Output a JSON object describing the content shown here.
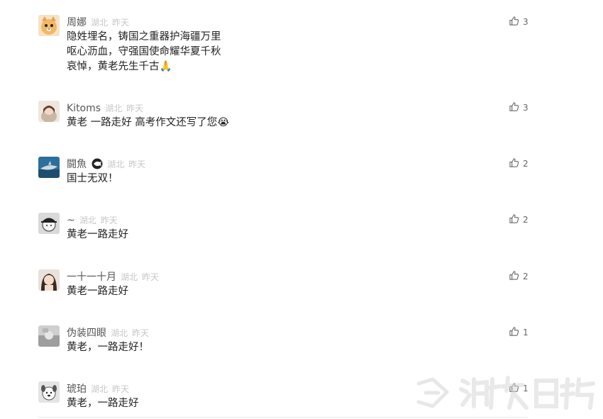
{
  "comments": [
    {
      "username": "周娜",
      "location": "湖北",
      "time": "昨天",
      "lines": [
        "隐姓埋名，铸国之重器护海疆万里",
        "呕心沥血，守强国使命耀华夏千秋",
        "哀悼，黄老先生千古🙏"
      ],
      "likes": "3",
      "avatar_icon": "cartoon-cat-avatar-icon"
    },
    {
      "username": "Kitoms",
      "location": "湖北",
      "time": "昨天",
      "lines": [
        "黄老 一路走好 高考作文还写了您😭"
      ],
      "likes": "3",
      "avatar_icon": "girl-photo-avatar-icon"
    },
    {
      "username": "闘魚",
      "location": "湖北",
      "time": "昨天",
      "lines": [
        "国士无双！"
      ],
      "likes": "2",
      "avatar_icon": "shark-photo-avatar-icon",
      "badge_icon": "fish-badge-icon"
    },
    {
      "username": "~",
      "location": "湖北",
      "time": "昨天",
      "lines": [
        "黄老一路走好"
      ],
      "likes": "2",
      "avatar_icon": "cartoon-cap-avatar-icon"
    },
    {
      "username": "一十一十月",
      "location": "湖北",
      "time": "昨天",
      "lines": [
        "黄老一路走好"
      ],
      "likes": "2",
      "avatar_icon": "woman-photo-avatar-icon"
    },
    {
      "username": "伪装四眼",
      "location": "湖北",
      "time": "昨天",
      "lines": [
        "黄老，一路走好！"
      ],
      "likes": "1",
      "avatar_icon": "grey-photo-avatar-icon"
    },
    {
      "username": "琥珀",
      "location": "湖北",
      "time": "昨天",
      "lines": [
        "黄老，一路走好"
      ],
      "likes": "1",
      "avatar_icon": "dog-cartoon-avatar-icon"
    }
  ],
  "watermark": "湖北日报",
  "colors": {
    "username": "#555555",
    "meta": "#c6c6c6",
    "body": "#222222",
    "like": "#666666"
  }
}
